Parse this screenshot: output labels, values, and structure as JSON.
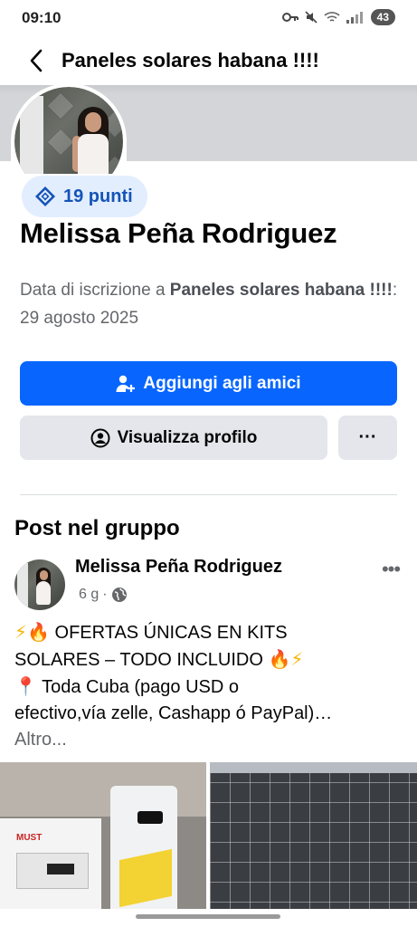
{
  "status_bar": {
    "time": "09:10",
    "battery": "43"
  },
  "header": {
    "title": "Paneles solares habana !!!!",
    "back_icon": "back-arrow-icon"
  },
  "profile": {
    "points_label": "19 punti",
    "name": "Melissa Peña Rodriguez",
    "join_prefix": "Data di iscrizione a ",
    "group_name": "Paneles solares habana !!!!",
    "join_suffix": ": 29 agosto 2025"
  },
  "actions": {
    "add_friend_label": "Aggiungi agli amici",
    "view_profile_label": "Visualizza profilo",
    "more_label": "···"
  },
  "posts_section": {
    "title": "Post nel gruppo"
  },
  "post": {
    "author": "Melissa Peña Rodriguez",
    "time": "6 g",
    "separator": "·",
    "menu_label": "•••",
    "line1_text": " OFERTAS ÚNICAS EN KITS",
    "line2_text": "SOLARES – TODO INCLUIDO ",
    "line3_text": " Toda Cuba (pago USD o",
    "line4_text": "efectivo,vía zelle, Cashapp ó PayPal)…",
    "more_link": "Altro...",
    "image_brand_label": "MUST"
  },
  "colors": {
    "primary": "#0866ff",
    "secondary_bg": "#e4e6eb",
    "points_bg": "#e2eefd",
    "points_text": "#1553b8"
  }
}
